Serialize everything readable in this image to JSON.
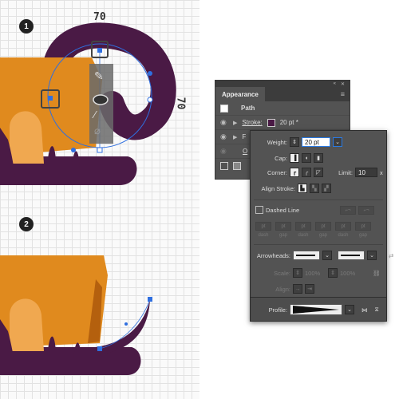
{
  "steps": [
    "1",
    "2"
  ],
  "measures": {
    "top": "70",
    "side": "70"
  },
  "colors": {
    "orange": "#e08a1e",
    "light_orange": "#f0a850",
    "dark_orange": "#b4600e",
    "purple": "#4a1a45",
    "anchor_blue": "#2f6fe0"
  },
  "tool_icons": [
    "pen-icon",
    "ellipse-icon",
    "brush-icon",
    "blob-brush-icon"
  ],
  "appearance": {
    "title": "Appearance",
    "path_label": "Path",
    "stroke_label": "Stroke:",
    "stroke_value": "20 pt *",
    "fill_label_partial": "F",
    "opacity_label_partial": "O",
    "menu_icon": "menu-icon"
  },
  "stroke_panel": {
    "weight_label": "Weight:",
    "weight_value": "20 pt",
    "cap_label": "Cap:",
    "corner_label": "Corner:",
    "limit_label": "Limit:",
    "limit_value": "10",
    "limit_unit": "x",
    "align_label": "Align Stroke:",
    "dashed_label": "Dashed Line",
    "dash_values": [
      "pt",
      "pt",
      "pt",
      "pt",
      "pt",
      "pt"
    ],
    "dash_labels": [
      "dash",
      "gap",
      "dash",
      "gap",
      "dash",
      "gap"
    ],
    "arrowheads_label": "Arrowheads:",
    "scale_label": "Scale:",
    "scale_values": [
      "100%",
      "100%"
    ],
    "align_arrow_label": "Align:",
    "profile_label": "Profile:"
  }
}
